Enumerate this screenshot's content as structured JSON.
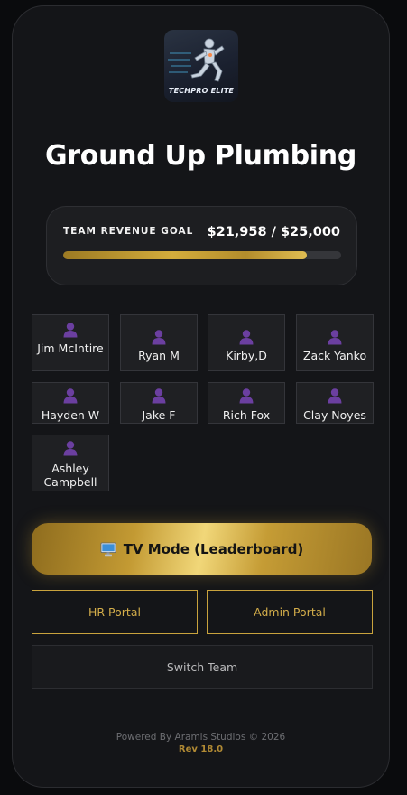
{
  "logo": {
    "text": "TECHPRO ELITE",
    "icon": "sprinter-logo"
  },
  "team": {
    "name": "Ground Up Plumbing"
  },
  "goal": {
    "label": "TEAM REVENUE GOAL",
    "value_text": "$21,958 / $25,000",
    "current": 21958,
    "target": 25000,
    "progress": 0.878
  },
  "members": [
    {
      "name": "Jim McIntire",
      "icon": "user-icon"
    },
    {
      "name": "Ryan M",
      "icon": "user-icon"
    },
    {
      "name": "Kirby,D",
      "icon": "user-icon"
    },
    {
      "name": "Zack Yanko",
      "icon": "user-icon"
    },
    {
      "name": "Hayden W",
      "icon": "user-icon"
    },
    {
      "name": "Jake F",
      "icon": "user-icon"
    },
    {
      "name": "Rich Fox",
      "icon": "user-icon"
    },
    {
      "name": "Clay Noyes",
      "icon": "user-icon"
    },
    {
      "name": "Ashley Campbell",
      "icon": "user-icon"
    }
  ],
  "buttons": {
    "tv_mode": "TV Mode (Leaderboard)",
    "tv_icon": "desktop-monitor-icon",
    "hr_portal": "HR Portal",
    "admin_portal": "Admin Portal",
    "switch_team": "Switch Team"
  },
  "footer": {
    "powered_by": "Powered By Aramis Studios © 2026",
    "rev": "Rev 18.0"
  },
  "colors": {
    "accent_gold": "#c9a33d",
    "avatar_purple": "#6b3fa0",
    "background": "#141518"
  }
}
